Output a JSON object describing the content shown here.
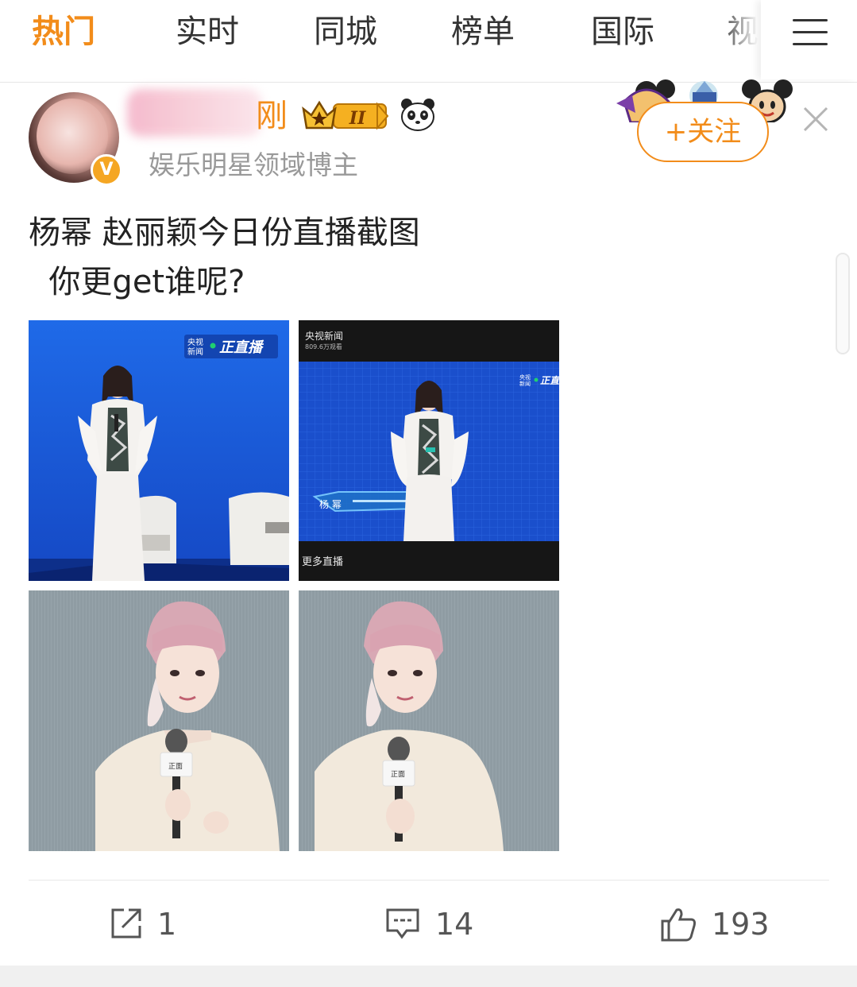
{
  "nav": {
    "tabs": [
      {
        "label": "热门",
        "active": true
      },
      {
        "label": "实时",
        "active": false
      },
      {
        "label": "同城",
        "active": false
      },
      {
        "label": "榜单",
        "active": false
      },
      {
        "label": "国际",
        "active": false
      },
      {
        "label": "视",
        "active": false
      }
    ],
    "menu_icon": "hamburger-menu-icon"
  },
  "user": {
    "name_visible": "刚",
    "bio": "娱乐明星领域博主",
    "verified_badge": "V",
    "level_badge": "II"
  },
  "follow_label": "+关注",
  "post": {
    "line1": "杨幂 赵丽颖今日份直播截图",
    "line2": "  你更get谁呢?"
  },
  "images": [
    {
      "overlay_channel": "央视\n新闻",
      "overlay_live": "正直播"
    },
    {
      "overlay_top": "央视新闻",
      "overlay_viewers": "809.6万观看",
      "overlay_live": "正直",
      "overlay_name": "杨 幂",
      "overlay_more": "更多直播"
    },
    {
      "mic_label": "正面"
    },
    {
      "mic_label": "正面"
    }
  ],
  "actions": {
    "repost_count": "1",
    "comment_count": "14",
    "like_count": "193"
  },
  "colors": {
    "accent": "#f28c1a",
    "image_blue_bg": "#1a56d6",
    "image_gray_bg": "#8e9aa0"
  }
}
